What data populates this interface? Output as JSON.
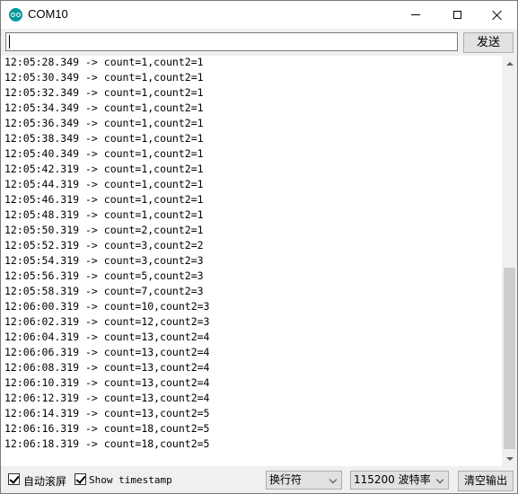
{
  "window": {
    "title": "COM10"
  },
  "input": {
    "value": "",
    "send_label": "发送"
  },
  "output_lines": [
    "12:05:28.349 -> count=1,count2=1",
    "12:05:30.349 -> count=1,count2=1",
    "12:05:32.349 -> count=1,count2=1",
    "12:05:34.349 -> count=1,count2=1",
    "12:05:36.349 -> count=1,count2=1",
    "12:05:38.349 -> count=1,count2=1",
    "12:05:40.349 -> count=1,count2=1",
    "12:05:42.319 -> count=1,count2=1",
    "12:05:44.319 -> count=1,count2=1",
    "12:05:46.319 -> count=1,count2=1",
    "12:05:48.319 -> count=1,count2=1",
    "12:05:50.319 -> count=2,count2=1",
    "12:05:52.319 -> count=3,count2=2",
    "12:05:54.319 -> count=3,count2=3",
    "12:05:56.319 -> count=5,count2=3",
    "12:05:58.319 -> count=7,count2=3",
    "12:06:00.319 -> count=10,count2=3",
    "12:06:02.319 -> count=12,count2=3",
    "12:06:04.319 -> count=13,count2=4",
    "12:06:06.319 -> count=13,count2=4",
    "12:06:08.319 -> count=13,count2=4",
    "12:06:10.319 -> count=13,count2=4",
    "12:06:12.319 -> count=13,count2=4",
    "12:06:14.319 -> count=13,count2=5",
    "12:06:16.319 -> count=18,count2=5",
    "12:06:18.319 -> count=18,count2=5"
  ],
  "bottom": {
    "autoscroll_label": "自动滚屏",
    "autoscroll_checked": true,
    "timestamp_label": "Show timestamp",
    "timestamp_checked": true,
    "line_ending": "换行符",
    "baud_rate": "115200 波特率",
    "clear_label": "清空输出"
  },
  "colors": {
    "app_icon": "#00979c",
    "thumb": "#cdcdcd"
  },
  "icons": [
    "arduino-app-icon",
    "minimize-icon",
    "maximize-icon",
    "close-icon",
    "scroll-up-icon",
    "scroll-down-icon",
    "chevron-down-icon",
    "checkmark-icon"
  ]
}
